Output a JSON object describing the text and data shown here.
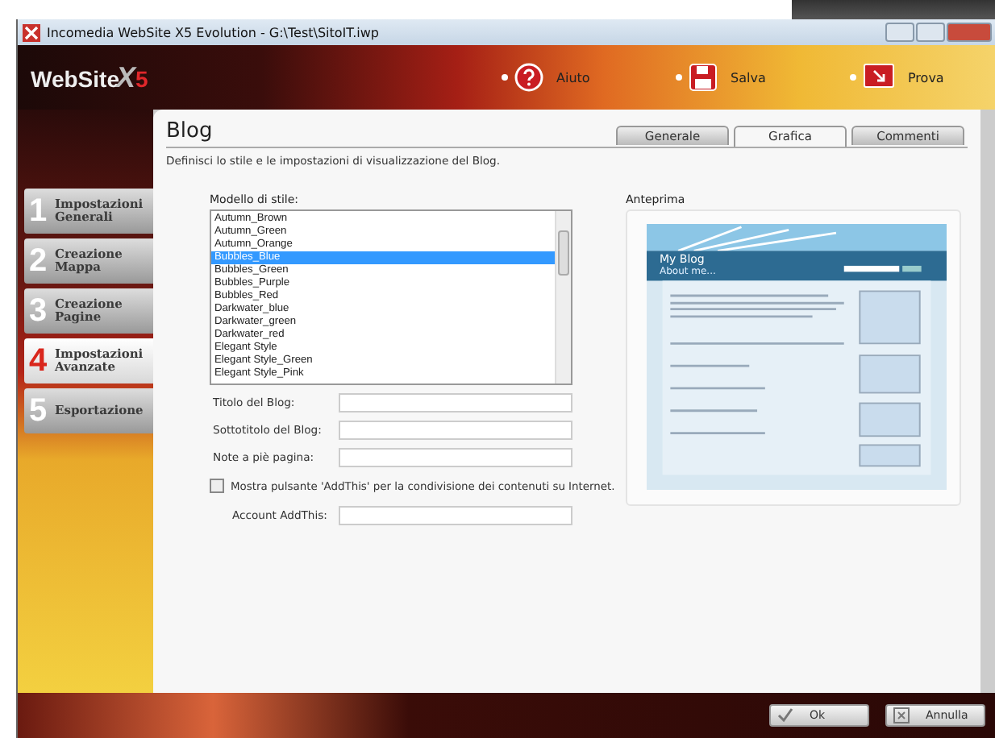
{
  "window": {
    "title": "Incomedia WebSite X5 Evolution - G:\\Test\\SitoIT.iwp"
  },
  "logo": {
    "name": "WebSite",
    "x": "X",
    "version": "5"
  },
  "toolbar": [
    {
      "label": "Aiuto",
      "kind": "help"
    },
    {
      "label": "Salva",
      "kind": "save"
    },
    {
      "label": "Prova",
      "kind": "preview"
    }
  ],
  "steps": [
    {
      "number": "1",
      "label": "Impostazioni Generali",
      "selected": false
    },
    {
      "number": "2",
      "label": "Creazione Mappa",
      "selected": false
    },
    {
      "number": "3",
      "label": "Creazione Pagine",
      "selected": false
    },
    {
      "number": "4",
      "label": "Impostazioni Avanzate",
      "selected": true
    },
    {
      "number": "5",
      "label": "Esportazione",
      "selected": false
    }
  ],
  "page": {
    "title": "Blog",
    "description": "Definisci lo stile e le impostazioni di visualizzazione del Blog."
  },
  "tabs": [
    {
      "label": "Generale",
      "selected": false
    },
    {
      "label": "Grafica",
      "selected": true
    },
    {
      "label": "Commenti",
      "selected": false
    }
  ],
  "style_list": {
    "label": "Modello di stile:",
    "items": [
      {
        "label": "Autumn_Brown",
        "selected": false
      },
      {
        "label": "Autumn_Green",
        "selected": false
      },
      {
        "label": "Autumn_Orange",
        "selected": false
      },
      {
        "label": "Bubbles_Blue",
        "selected": true
      },
      {
        "label": "Bubbles_Green",
        "selected": false
      },
      {
        "label": "Bubbles_Purple",
        "selected": false
      },
      {
        "label": "Bubbles_Red",
        "selected": false
      },
      {
        "label": "Darkwater_blue",
        "selected": false
      },
      {
        "label": "Darkwater_green",
        "selected": false
      },
      {
        "label": "Darkwater_red",
        "selected": false
      },
      {
        "label": "Elegant Style",
        "selected": false
      },
      {
        "label": "Elegant Style_Green",
        "selected": false
      },
      {
        "label": "Elegant Style_Pink",
        "selected": false
      }
    ]
  },
  "fields": [
    {
      "label": "Titolo del Blog:"
    },
    {
      "label": "Sottotitolo del Blog:"
    },
    {
      "label": "Note a piè pagina:"
    }
  ],
  "addthis": {
    "label": "Mostra pulsante 'AddThis' per la condivisione dei contenuti su Internet.",
    "checked": false
  },
  "account_field": {
    "label": "Account AddThis:"
  },
  "preview": {
    "label": "Anteprima",
    "blog_title": "My Blog",
    "blog_subtitle": "About me..."
  },
  "buttons": [
    {
      "label": "Ok",
      "kind": "ok"
    },
    {
      "label": "Annulla",
      "kind": "cancel"
    }
  ]
}
